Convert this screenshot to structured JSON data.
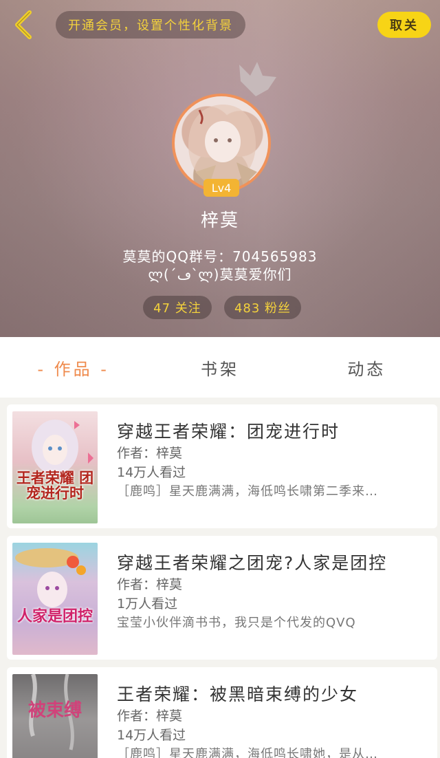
{
  "header": {
    "vip_banner": "开通会员，设置个性化背景",
    "follow_button": "取关",
    "level": "Lv4",
    "nickname": "梓莫",
    "bio_line1": "莫莫的QQ群号：704565983",
    "bio_line2": "ლ(´ڡ`ლ)莫莫爱你们",
    "following": "47 关注",
    "fans": "483 粉丝",
    "accent_color": "#f7d416"
  },
  "tabs": [
    {
      "label": "- 作品 -",
      "active": true
    },
    {
      "label": "书架",
      "active": false
    },
    {
      "label": "动态",
      "active": false
    }
  ],
  "books": [
    {
      "title": "穿越王者荣耀：团宠进行时",
      "author": "作者：梓莫",
      "reads": "14万人看过",
      "desc": "［鹿鸣］星天鹿满满，海低鸣长啸第二季来…",
      "cover_text": "王者荣耀 团宠进行时",
      "cover_color": "#e9c4c8"
    },
    {
      "title": "穿越王者荣耀之团宠?人家是团控",
      "author": "作者：梓莫",
      "reads": "1万人看过",
      "desc": "宝莹小伙伴滴书书，我只是个代发的QVQ",
      "cover_text": "人家是团控",
      "cover_color": "#c9b6d8"
    },
    {
      "title": "王者荣耀：被黑暗束缚的少女",
      "author": "作者：梓莫",
      "reads": "14万人看过",
      "desc": "［鹿鸣］星天鹿满满，海低鸣长啸她，是从…",
      "cover_text": "被束缚",
      "cover_color": "#8c8a8a"
    }
  ]
}
